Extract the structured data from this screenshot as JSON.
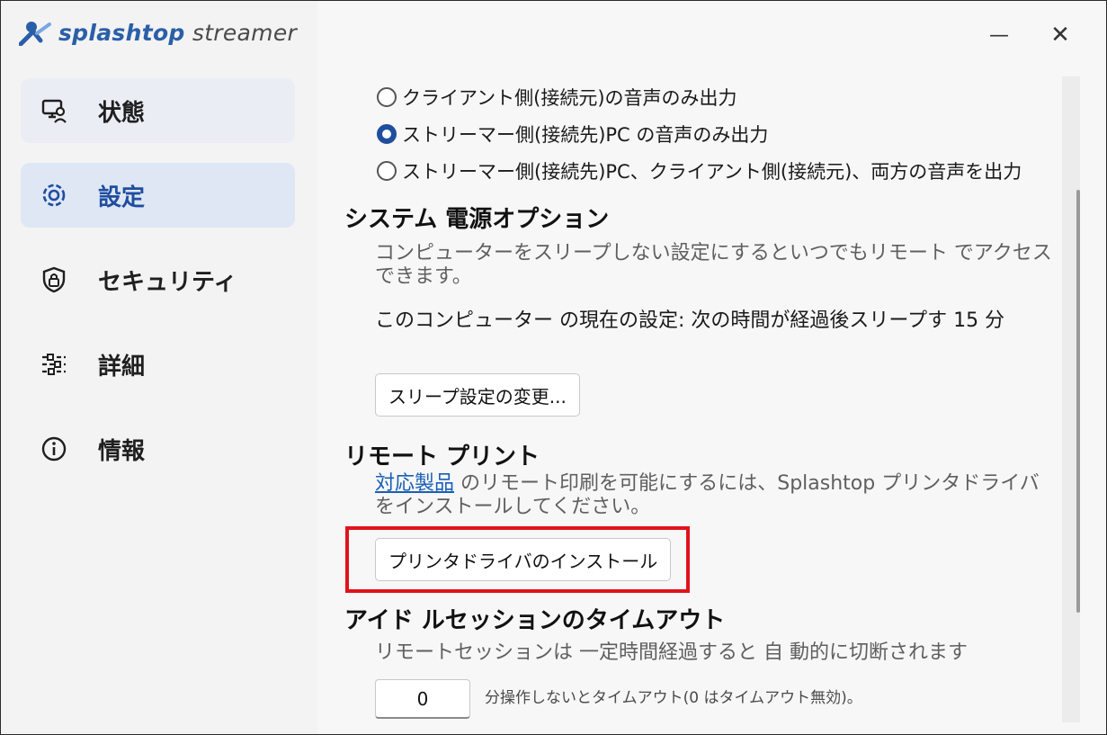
{
  "brand": {
    "name_bold": "splashtop",
    "name_light": " streamer"
  },
  "sidebar": {
    "items": [
      {
        "label": "状態",
        "icon": "status-icon"
      },
      {
        "label": "設定",
        "icon": "gear-icon"
      },
      {
        "label": "セキュリティ",
        "icon": "lock-shield-icon"
      },
      {
        "label": "詳細",
        "icon": "sliders-icon"
      },
      {
        "label": "情報",
        "icon": "info-icon"
      }
    ]
  },
  "window": {
    "minimize": "—",
    "close": "✕"
  },
  "audio": {
    "options": [
      {
        "label": "クライアント側(接続元)の音声のみ出力",
        "checked": false
      },
      {
        "label": "ストリーマー側(接続先)PC の音声のみ出力",
        "checked": true
      },
      {
        "label": "ストリーマー側(接続先)PC、クライアント側(接続元)、両方の音声を出力",
        "checked": false
      }
    ]
  },
  "power": {
    "title": "システム 電源オプション",
    "desc": "コンピューターをスリープしない設定にするといつでもリモート でアクセスできます。",
    "current": "このコンピューター の現在の設定: 次の時間が経過後スリープす 15 分",
    "button": "スリープ設定の変更..."
  },
  "remote_print": {
    "title": "リモート プリント",
    "link": "対応製品",
    "desc_rest": " のリモート印刷を可能にするには、Splashtop プリンタドライバをインストールしてください。",
    "button": "プリンタドライバのインストール"
  },
  "idle": {
    "title": "アイド ルセッションのタイムアウト",
    "desc": "リモートセッションは 一定時間経過すると 自 動的に切断されます",
    "value": "0",
    "note": "分操作しないとタイムアウト(0 はタイムアウト無効)。"
  },
  "colors": {
    "accent": "#1f4e9e",
    "highlight": "#e0131b",
    "link": "#1a5fb4"
  }
}
